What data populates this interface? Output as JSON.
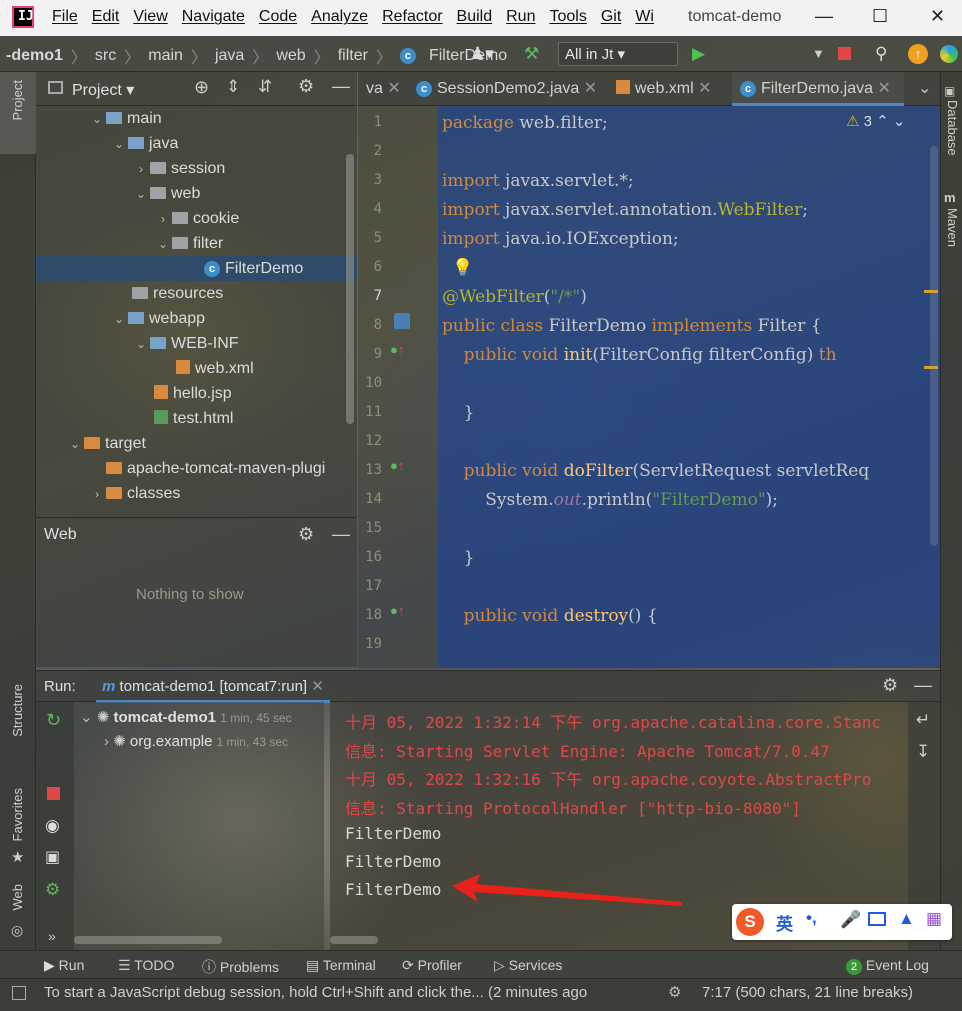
{
  "window": {
    "title": "tomcat-demo",
    "menu": [
      "File",
      "Edit",
      "View",
      "Navigate",
      "Code",
      "Analyze",
      "Refactor",
      "Build",
      "Run",
      "Tools",
      "Git",
      "Wi"
    ]
  },
  "breadcrumb": [
    "-demo1",
    "src",
    "main",
    "java",
    "web",
    "filter",
    "FilterDemo"
  ],
  "toolbar": {
    "run_config": "All in Jt"
  },
  "project_panel": {
    "title": "Project",
    "tree": [
      {
        "label": "main",
        "icon": "folder-blue",
        "expanded": true
      },
      {
        "label": "java",
        "icon": "folder-blue",
        "expanded": true
      },
      {
        "label": "session",
        "icon": "package",
        "expanded": false
      },
      {
        "label": "web",
        "icon": "package",
        "expanded": true
      },
      {
        "label": "cookie",
        "icon": "package",
        "expanded": false
      },
      {
        "label": "filter",
        "icon": "package",
        "expanded": true
      },
      {
        "label": "FilterDemo",
        "icon": "class",
        "selected": true
      },
      {
        "label": "resources",
        "icon": "folder-resources"
      },
      {
        "label": "webapp",
        "icon": "folder-blue",
        "expanded": true
      },
      {
        "label": "WEB-INF",
        "icon": "folder-blue",
        "expanded": true
      },
      {
        "label": "web.xml",
        "icon": "xml-file"
      },
      {
        "label": "hello.jsp",
        "icon": "jsp-file"
      },
      {
        "label": "test.html",
        "icon": "html-file"
      },
      {
        "label": "target",
        "icon": "folder-orange",
        "expanded": true
      },
      {
        "label": "apache-tomcat-maven-plugi",
        "icon": "folder-orange"
      },
      {
        "label": "classes",
        "icon": "folder-orange",
        "expanded": false
      }
    ]
  },
  "web_panel": {
    "title": "Web",
    "empty_text": "Nothing to show"
  },
  "editor": {
    "tabs": [
      {
        "label": "va"
      },
      {
        "label": "SessionDemo2.java"
      },
      {
        "label": "web.xml"
      },
      {
        "label": "FilterDemo.java",
        "active": true
      }
    ],
    "warnings": "3",
    "line_numbers": [
      "1",
      "2",
      "3",
      "4",
      "5",
      "6",
      "7",
      "8",
      "9",
      "10",
      "11",
      "12",
      "13",
      "14",
      "15",
      "16",
      "17",
      "18",
      "19"
    ],
    "lines": {
      "l1_kw": "package",
      "l1_rest": " web.filter;",
      "l3_kw": "import",
      "l3_rest": " javax.servlet.*;",
      "l4_kw": "import",
      "l4_rest": " javax.servlet.annotation.",
      "l4_ann": "WebFilter",
      "l4_end": ";",
      "l5_kw": "import",
      "l5_rest": " java.io.IOException;",
      "l7_ann": "@WebFilter",
      "l7_p1": "(",
      "l7_str": "\"/*\"",
      "l7_p2": ")",
      "l8_kw": "public class",
      "l8_rest": " FilterDemo ",
      "l8_kw2": "implements",
      "l8_rest2": " Filter {",
      "l9_kw": "    public void",
      "l9_fn": " init",
      "l9_rest": "(FilterConfig filterConfig) ",
      "l9_kw2": "th",
      "l11": "    }",
      "l13_kw": "    public void",
      "l13_fn": " doFilter",
      "l13_rest": "(ServletRequest servletReq",
      "l14_a": "        System.",
      "l14_it": "out",
      "l14_b": ".println(",
      "l14_str": "\"FilterDemo\"",
      "l14_c": ");",
      "l16": "    }",
      "l18_kw": "    public void",
      "l18_fn": " destroy",
      "l18_rest": "() {"
    }
  },
  "run_panel": {
    "label": "Run:",
    "config_tab": "tomcat-demo1 [tomcat7:run]",
    "tree": [
      {
        "label": "tomcat-demo1",
        "time": "1 min, 45 sec"
      },
      {
        "label": "org.example",
        "time": "1 min, 43 sec"
      }
    ],
    "console": [
      {
        "text": "十月 05, 2022 1:32:14 下午 org.apache.catalina.core.Stanc",
        "color": "red"
      },
      {
        "text": "信息: Starting Servlet Engine: Apache Tomcat/7.0.47",
        "color": "red"
      },
      {
        "text": "十月 05, 2022 1:32:16 下午 org.apache.coyote.AbstractPro",
        "color": "red"
      },
      {
        "text": "信息: Starting ProtocolHandler [\"http-bio-8080\"]",
        "color": "red"
      },
      {
        "text": "FilterDemo",
        "color": "white"
      },
      {
        "text": "FilterDemo",
        "color": "white"
      },
      {
        "text": "FilterDemo",
        "color": "white"
      }
    ]
  },
  "side_labels": {
    "left": [
      "Project",
      "Structure",
      "Favorites",
      "Web"
    ],
    "right": [
      "Database",
      "Maven"
    ]
  },
  "bottom_tabs": [
    "Run",
    "TODO",
    "Problems",
    "Terminal",
    "Profiler",
    "Services"
  ],
  "event_log": {
    "count": "2",
    "label": "Event Log"
  },
  "status": {
    "message": "To start a JavaScript debug session, hold Ctrl+Shift and click the... (2 minutes ago",
    "position": "7:17 (500 chars, 21 line breaks)"
  },
  "ime": {
    "lang": "英"
  },
  "colors": {
    "accent": "#4a88c7",
    "selection": "#214283",
    "console_error": "#e04848",
    "annotation_arrow": "#e8221b"
  }
}
